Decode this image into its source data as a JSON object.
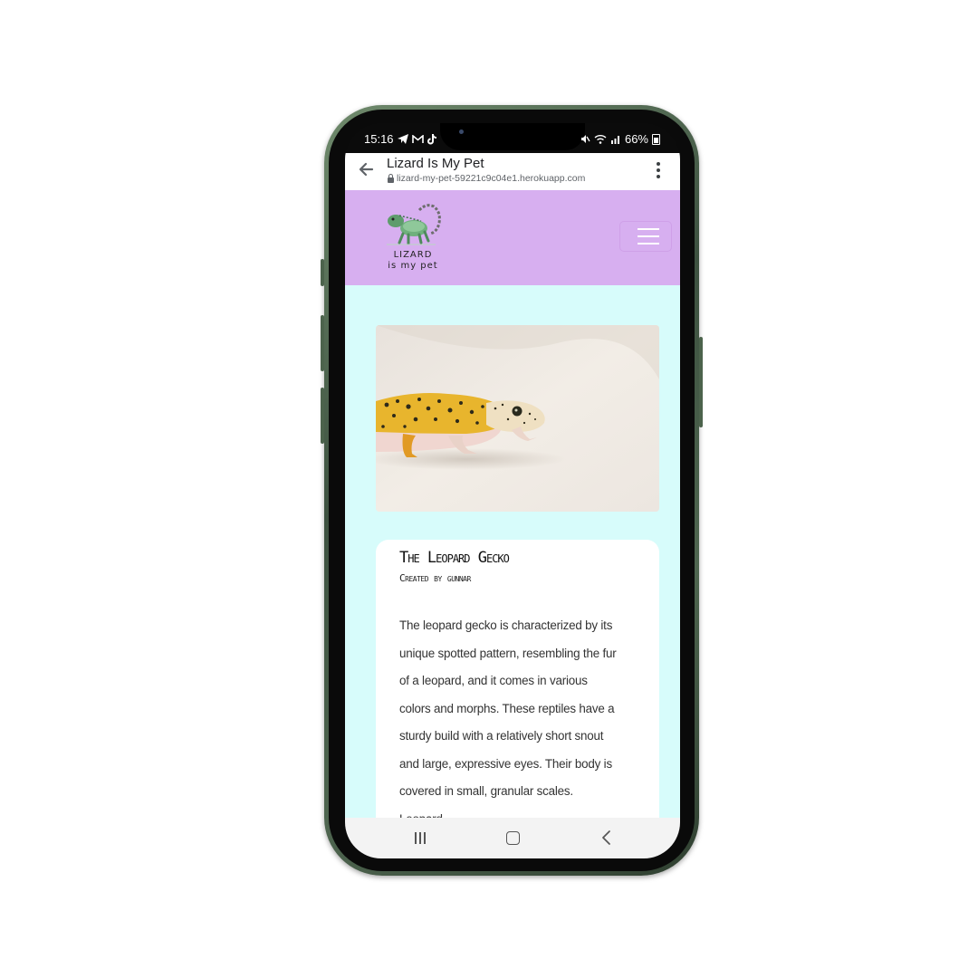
{
  "status_bar": {
    "time": "15:16",
    "left_icons": [
      "telegram-icon",
      "gmail-icon",
      "tiktok-icon"
    ],
    "right_icons": [
      "mute-icon",
      "wifi-icon",
      "signal-icon"
    ],
    "battery": "66%"
  },
  "browser": {
    "tab_title": "Lizard Is My Pet",
    "url": "lizard-my-pet-59221c9c04e1.herokuapp.com"
  },
  "site": {
    "logo_line1": "LIZARD",
    "logo_line2": "is my pet",
    "header_color": "#d7aff0",
    "background_color": "#d7fcfb"
  },
  "post": {
    "title": "The Leopard Gecko",
    "subtitle": "Created by gunnar",
    "body": "The leopard gecko is characterized by its unique spotted pattern, resembling the fur of a leopard, and it comes in various colors and morphs. These reptiles have a sturdy build with a relatively short snout and large, expressive eyes. Their body is covered in small, granular scales. Leopard"
  }
}
